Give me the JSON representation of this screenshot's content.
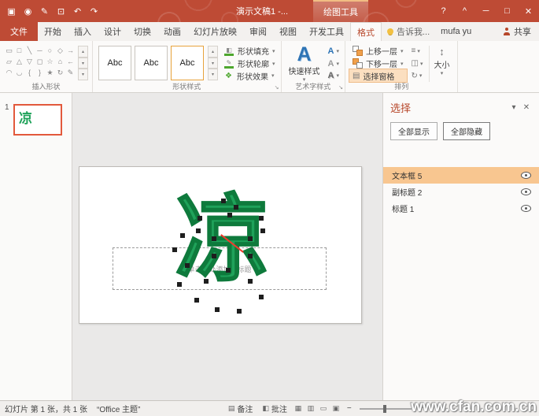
{
  "colors": {
    "accent": "#B7472A",
    "titlebar": "#BE4B35",
    "selection_highlight": "#F8C690",
    "shape_green": "#1FA25A"
  },
  "titlebar": {
    "title": "演示文稿1 -...",
    "contextual_label": "绘图工具",
    "qat": [
      {
        "name": "save-icon",
        "glyph": "▣"
      },
      {
        "name": "touch-mode-icon",
        "glyph": "◉"
      },
      {
        "name": "pen-icon",
        "glyph": "✎"
      },
      {
        "name": "slideshow-icon",
        "glyph": "⊡"
      },
      {
        "name": "undo-icon",
        "glyph": "↶"
      },
      {
        "name": "redo-icon",
        "glyph": "↷"
      }
    ],
    "window": [
      {
        "name": "help",
        "glyph": "?"
      },
      {
        "name": "ribbon-display-options",
        "glyph": "^"
      },
      {
        "name": "minimize",
        "glyph": "─"
      },
      {
        "name": "restore",
        "glyph": "□"
      },
      {
        "name": "close",
        "glyph": "✕"
      }
    ]
  },
  "tabs": [
    {
      "label": "文件"
    },
    {
      "label": "开始"
    },
    {
      "label": "插入"
    },
    {
      "label": "设计"
    },
    {
      "label": "切换"
    },
    {
      "label": "动画"
    },
    {
      "label": "幻灯片放映"
    },
    {
      "label": "审阅"
    },
    {
      "label": "视图"
    },
    {
      "label": "开发工具"
    },
    {
      "label": "格式"
    }
  ],
  "tab_extras": {
    "tellme": "告诉我...",
    "user": "mufa yu",
    "share": "共享"
  },
  "ribbon": {
    "insert_shapes": {
      "label": "插入形状",
      "rows": [
        [
          "▭",
          "□",
          "╲",
          "─",
          "○",
          "◇",
          "→"
        ],
        [
          "▱",
          "△",
          "▽",
          "◻",
          "☆",
          "⌂",
          "←"
        ],
        [
          "◠",
          "◡",
          "{",
          "}",
          "★",
          "↻",
          "✎"
        ]
      ],
      "scroll": [
        "▴",
        "▾",
        "▾"
      ]
    },
    "shape_styles": {
      "label": "形状样式",
      "gallery": [
        "Abc",
        "Abc",
        "Abc"
      ],
      "fill": "形状填充",
      "outline": "形状轮廓",
      "effects": "形状效果",
      "fill_glyph": "◧",
      "outline_glyph": "✎",
      "effects_glyph": "❖"
    },
    "wordart": {
      "label": "艺术字样式",
      "big_a": "A",
      "quick_styles": "快速样式",
      "mini_a": [
        "A",
        "A",
        "A"
      ]
    },
    "arrange": {
      "label": "排列",
      "bring_forward": "上移一层",
      "send_backward": "下移一层",
      "selection_pane": "选择窗格",
      "selection_pane_glyph": "▤",
      "align_glyph": "≡",
      "group_glyph": "◫",
      "rotate_glyph": "↻",
      "size": "大小",
      "size_glyph": "↕"
    }
  },
  "slide_panel": {
    "number": "1",
    "char": "凉"
  },
  "canvas": {
    "char": "凉",
    "placeholder": "单击此处添加副标题"
  },
  "selection_pane": {
    "title": "选择",
    "dropdown_glyph": "▾",
    "close_glyph": "✕",
    "show_all": "全部显示",
    "hide_all": "全部隐藏",
    "items": [
      {
        "label": "文本框 5"
      },
      {
        "label": "副标题 2"
      },
      {
        "label": "标题 1"
      }
    ]
  },
  "statusbar": {
    "slide_info": "幻灯片 第 1 张，共 1 张",
    "theme": "“Office 主题”",
    "notes": "备注",
    "notes_glyph": "▤",
    "comments": "批注",
    "comments_glyph": "◧",
    "view_icons": [
      {
        "name": "normal-view-icon",
        "glyph": "▦"
      },
      {
        "name": "slide-sorter-icon",
        "glyph": "▥"
      },
      {
        "name": "reading-view-icon",
        "glyph": "▭"
      },
      {
        "name": "slideshow-view-icon",
        "glyph": "▣"
      }
    ],
    "zoom_out": "−",
    "zoom_in": "+",
    "fit_glyph": "⊡",
    "watermark": "www.cfan.com.cn"
  }
}
